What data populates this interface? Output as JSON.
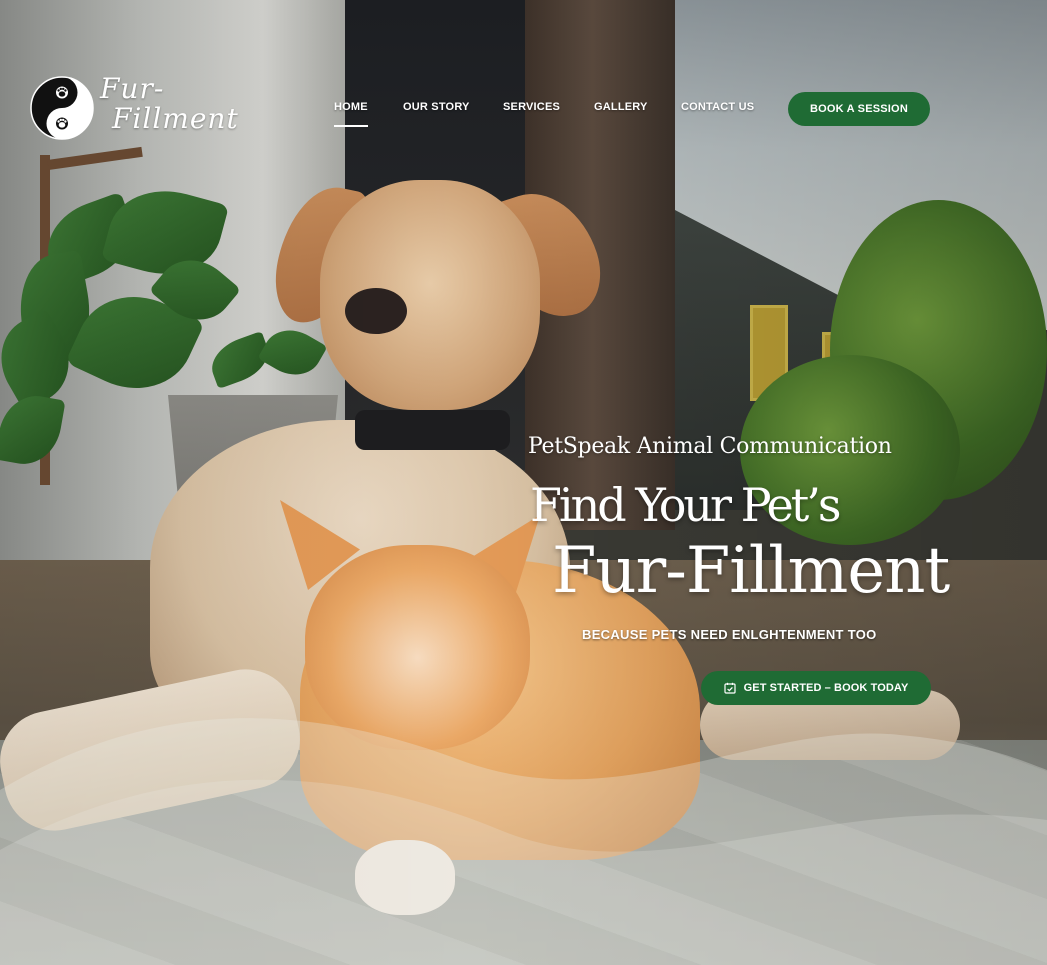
{
  "brand": {
    "name_line1": "Fur-",
    "name_line2": "Fillment"
  },
  "nav": {
    "items": [
      {
        "label": "HOME",
        "active": true
      },
      {
        "label": "OUR STORY",
        "active": false
      },
      {
        "label": "SERVICES",
        "active": false
      },
      {
        "label": "GALLERY",
        "active": false
      },
      {
        "label": "CONTACT US",
        "active": false
      }
    ],
    "book_button": "BOOK A SESSION"
  },
  "hero": {
    "eyebrow": "PetSpeak Animal Communication",
    "headline_line1": "Find Your Pet’s",
    "headline_line2": "Fur-Fillment",
    "tagline": "BECAUSE PETS NEED ENLGHTENMENT TOO",
    "cta_label": "GET STARTED – BOOK TODAY",
    "cta_icon": "calendar-check-icon"
  },
  "colors": {
    "accent_green": "#1f6b34",
    "text_white": "#ffffff"
  }
}
